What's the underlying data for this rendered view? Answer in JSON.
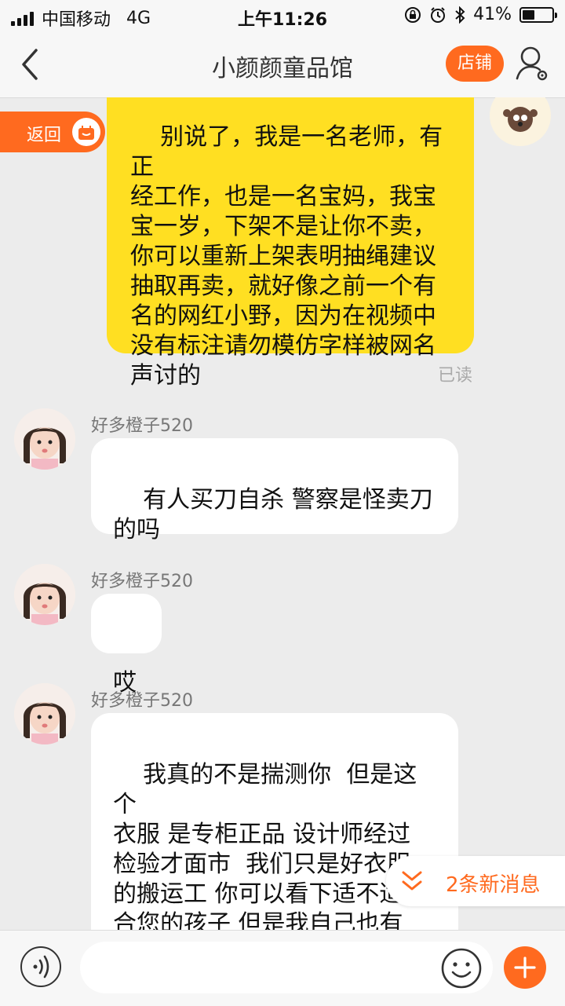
{
  "status_bar": {
    "carrier": "中国移动",
    "network": "4G",
    "time": "上午11:26",
    "battery_percent": "41%",
    "battery_level": 0.41
  },
  "header": {
    "title": "小颜颜童品馆",
    "shop_label": "店铺",
    "back_icon": "chevron-left-icon",
    "profile_icon": "user-settings-icon"
  },
  "return_tab": {
    "label": "返回"
  },
  "messages": [
    {
      "direction": "out",
      "text": "别说了，我是一名老师，有正\n经工作，也是一名宝妈，我宝\n宝一岁，下架不是让你不卖，\n你可以重新上架表明抽绳建议\n抽取再卖，就好像之前一个有\n名的网红小野，因为在视频中\n没有标注请勿模仿字样被网名\n声讨的",
      "status": "已读"
    },
    {
      "direction": "in",
      "sender": "好多橙子520",
      "text": "有人买刀自杀 警察是怪卖刀\n的吗"
    },
    {
      "direction": "in",
      "sender": "好多橙子520",
      "text": "哎"
    },
    {
      "direction": "in",
      "sender": "好多橙子520",
      "text": "我真的不是揣测你  但是这个\n衣服 是专柜正品 设计师经过\n检验才面市  我们只是好衣服\n的搬运工 你可以看下适不适\n合您的孩子 但是我自己也有\n孩子"
    }
  ],
  "new_messages": {
    "label": "2条新消息"
  },
  "input_bar": {
    "placeholder": ""
  },
  "colors": {
    "accent": "#ff6a1f",
    "outgoing_bubble": "#ffdf22",
    "background": "#ececec"
  }
}
